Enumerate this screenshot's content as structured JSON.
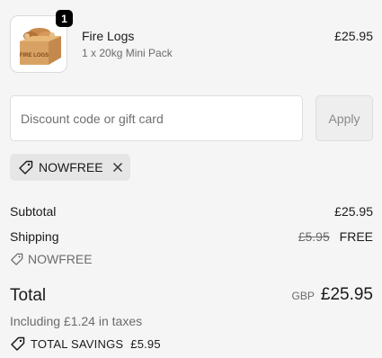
{
  "product": {
    "name": "Fire Logs",
    "variant": "1 x 20kg Mini Pack",
    "price": "£25.95",
    "quantity": "1",
    "image_box_text": "FIRE LOGS",
    "image_icon": "box-of-logs-icon"
  },
  "discount": {
    "placeholder": "Discount code or gift card",
    "apply_label": "Apply",
    "applied_code": "NOWFREE"
  },
  "summary": {
    "subtotal_label": "Subtotal",
    "subtotal_value": "£25.95",
    "shipping_label": "Shipping",
    "shipping_original": "£5.95",
    "shipping_value": "FREE",
    "shipping_code": "NOWFREE",
    "total_label": "Total",
    "currency": "GBP",
    "total_value": "£25.95",
    "taxes_text": "Including £1.24 in taxes",
    "savings_label": "TOTAL SAVINGS",
    "savings_value": "£5.95"
  },
  "colors": {
    "background": "#f5f5f5",
    "chip": "#e6e6e6",
    "badge": "#000000"
  }
}
